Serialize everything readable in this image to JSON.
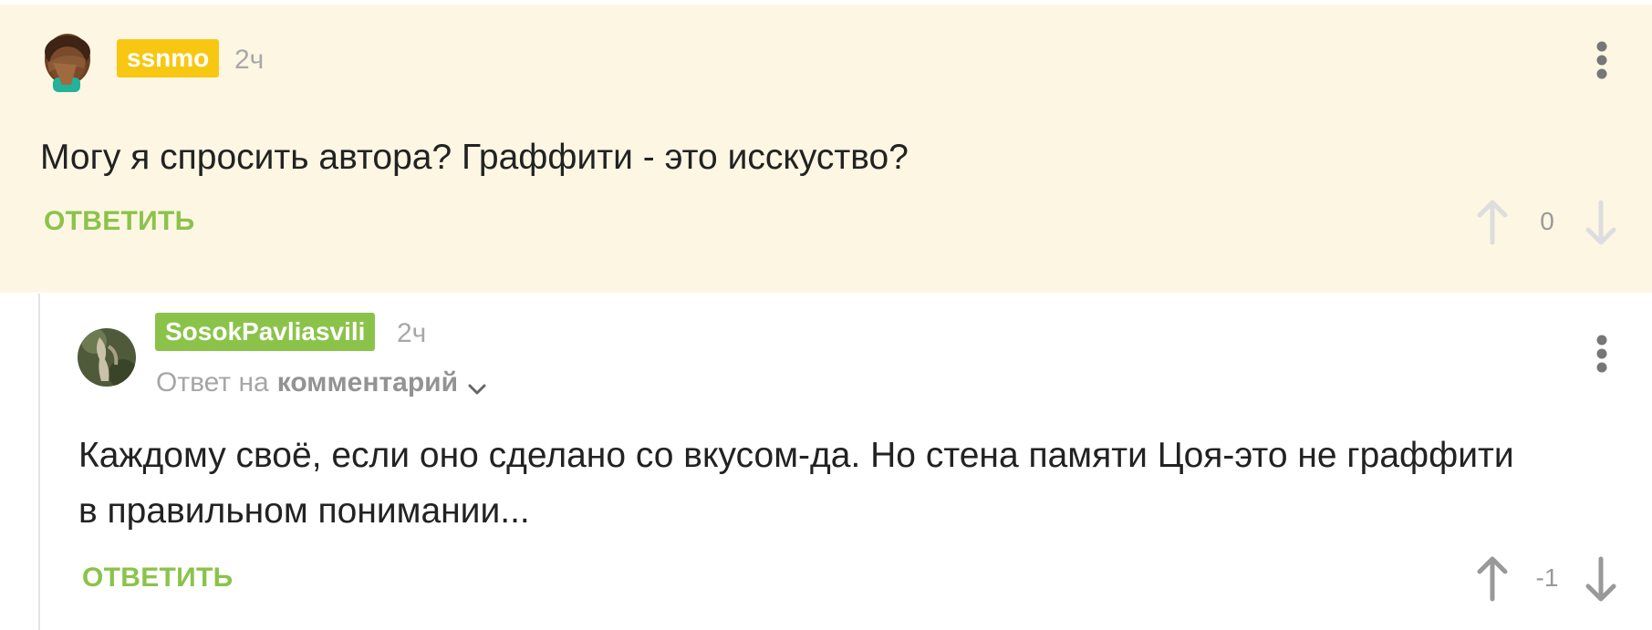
{
  "comments": [
    {
      "username": "ssnmo",
      "time": "2ч",
      "body": "Могу я спросить автора? Граффити - это исскуство?",
      "reply_label": "ОТВЕТИТЬ",
      "score": "0",
      "avatar": "facepalm-emoji-avatar",
      "username_color": "#f8c711"
    },
    {
      "username": "SosokPavliasvili",
      "time": "2ч",
      "reply_to_prefix": "Ответ на",
      "reply_to_link": "комментарий",
      "body": "Каждому своё, если оно сделано со вкусом-да. Но стена памяти Цоя-это не граффити в правильном понимании...",
      "reply_label": "ОТВЕТИТЬ",
      "score": "-1",
      "avatar": "photo-avatar",
      "username_color": "#8bc34a"
    }
  ],
  "colors": {
    "highlight_bg": "#fdf6e3",
    "accent_green": "#8bc34a",
    "muted_text": "#a8a8a8"
  },
  "icons": [
    "more-icon",
    "arrow-up-icon",
    "arrow-down-icon",
    "chevron-down-icon"
  ]
}
